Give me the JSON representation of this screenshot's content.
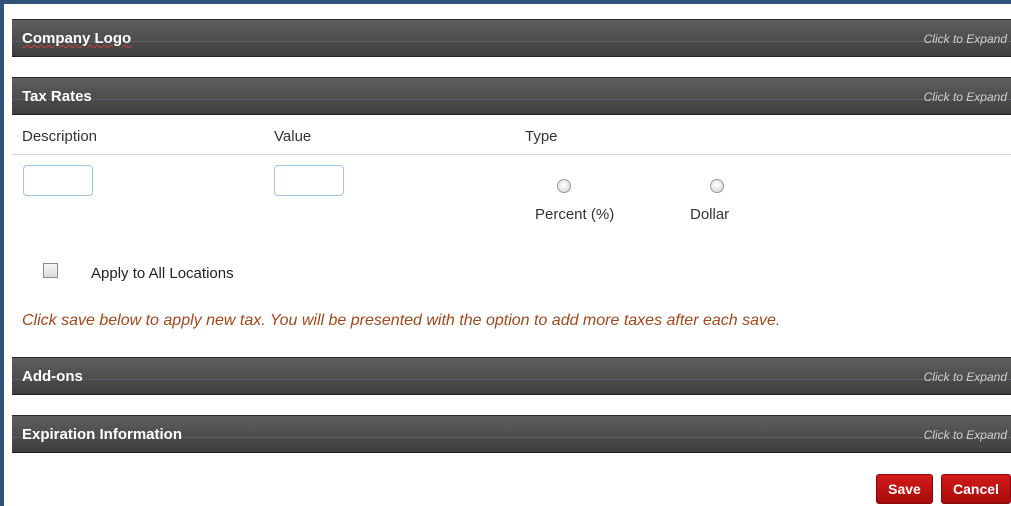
{
  "sections": {
    "company_logo": {
      "title": "Company Logo",
      "expand": "Click to Expand"
    },
    "tax_rates": {
      "title": "Tax Rates",
      "expand": "Click to Expand"
    },
    "addons": {
      "title": "Add-ons",
      "expand": "Click to Expand"
    },
    "expiration": {
      "title": "Expiration Information",
      "expand": "Click to Expand"
    }
  },
  "tax_form": {
    "col_description": "Description",
    "col_value": "Value",
    "col_type": "Type",
    "description_value": "",
    "value_value": "",
    "type_options": [
      "Percent (%)",
      "Dollar"
    ],
    "apply_all_label": "Apply to All Locations",
    "apply_all_checked": false,
    "notice": "Click save below to apply new tax. You will be presented with the option to add more taxes after each save."
  },
  "buttons": {
    "save": "Save",
    "cancel": "Cancel"
  },
  "colors": {
    "accent_red": "#c01010",
    "notice_text": "#a4481b",
    "bar": "#4a4a4a"
  }
}
